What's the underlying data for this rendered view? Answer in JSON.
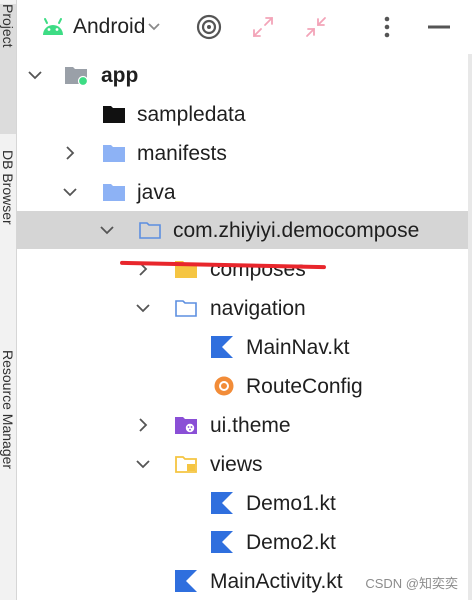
{
  "side_stripe": {
    "tabs": [
      "Project",
      "DB Browser",
      "Resource Manager"
    ]
  },
  "toolbar": {
    "view_selector": "Android",
    "icons": [
      "android-icon",
      "chevron-down-icon",
      "locate-target-icon",
      "expand-all-icon",
      "collapse-all-icon",
      "more-options-icon",
      "hide-panel-icon"
    ]
  },
  "tree": {
    "app": "app",
    "sampledata": "sampledata",
    "manifests": "manifests",
    "java": "java",
    "package": "com.zhiyiyi.democompose",
    "composes": "composes",
    "navigation": "navigation",
    "mainnav": "MainNav.kt",
    "routeconfig": "RouteConfig",
    "uitheme": "ui.theme",
    "views": "views",
    "demo1": "Demo1.kt",
    "demo2": "Demo2.kt",
    "mainactivity": "MainActivity.kt"
  },
  "watermark": "CSDN @知奕奕",
  "colors": {
    "folder_blue": "#8db2f5",
    "folder_yellow": "#f5c542",
    "kotlin_blue": "#2f6fde",
    "android_green": "#3ddc84",
    "selection": "#d5d5d5",
    "annotation_red": "#e8262c"
  }
}
